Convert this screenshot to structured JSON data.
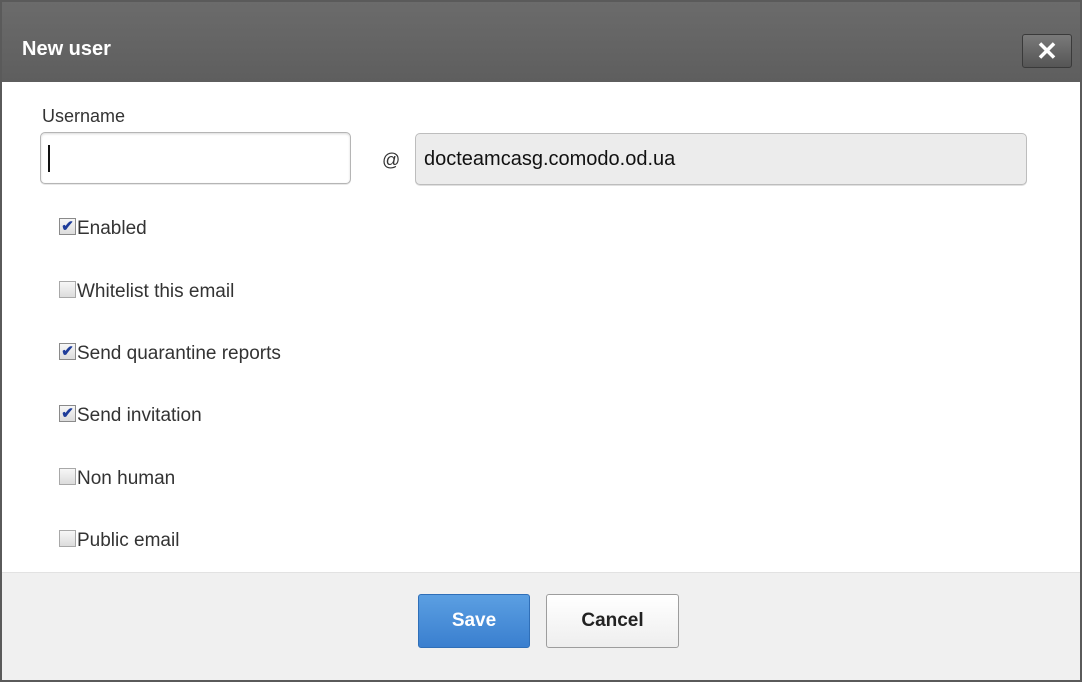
{
  "dialog": {
    "title": "New user",
    "close_label": "✕"
  },
  "form": {
    "username_label": "Username",
    "username_value": "",
    "at_sign": "@",
    "domain_value": "docteamcasg.comodo.od.ua"
  },
  "options": [
    {
      "label": "Enabled",
      "checked": true
    },
    {
      "label": "Whitelist this email",
      "checked": false
    },
    {
      "label": "Send quarantine reports",
      "checked": true
    },
    {
      "label": "Send invitation",
      "checked": true
    },
    {
      "label": "Non human",
      "checked": false
    },
    {
      "label": "Public email",
      "checked": false
    }
  ],
  "footer": {
    "save_label": "Save",
    "cancel_label": "Cancel"
  },
  "colors": {
    "titlebar": "#5e5e5e",
    "primary_button": "#3a7fcf",
    "check_mark": "#1f3d9a"
  }
}
